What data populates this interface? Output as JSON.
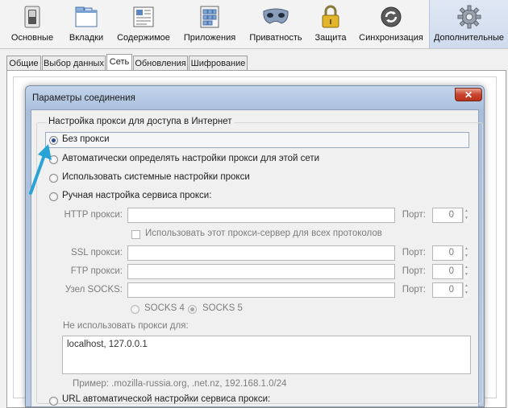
{
  "toolbar": {
    "items": [
      {
        "label": "Основные",
        "icon": "switch-icon"
      },
      {
        "label": "Вкладки",
        "icon": "tabs-icon"
      },
      {
        "label": "Содержимое",
        "icon": "content-icon"
      },
      {
        "label": "Приложения",
        "icon": "applications-icon"
      },
      {
        "label": "Приватность",
        "icon": "privacy-mask-icon"
      },
      {
        "label": "Защита",
        "icon": "padlock-icon"
      },
      {
        "label": "Синхронизация",
        "icon": "sync-icon"
      },
      {
        "label": "Дополнительные",
        "icon": "gear-icon"
      }
    ],
    "active": "Дополнительные"
  },
  "tabs": [
    {
      "label": "Общие"
    },
    {
      "label": "Выбор данных"
    },
    {
      "label": "Сеть"
    },
    {
      "label": "Обновления"
    },
    {
      "label": "Шифрование"
    }
  ],
  "active_tab": "Сеть",
  "dialog": {
    "title": "Параметры соединения",
    "close_label": "✕",
    "legend": "Настройка прокси для доступа в Интернет",
    "options": {
      "no_proxy": "Без прокси",
      "auto_detect": "Автоматически определять настройки прокси для этой сети",
      "system": "Использовать системные настройки прокси",
      "manual": "Ручная настройка сервиса прокси:",
      "auto_url": "URL автоматической настройки сервиса прокси:"
    },
    "selected_option": "no_proxy",
    "manual": {
      "http_label": "HTTP прокси:",
      "ssl_label": "SSL прокси:",
      "ftp_label": "FTP прокси:",
      "socks_label": "Узел SOCKS:",
      "port_label": "Порт:",
      "http_port": "0",
      "ssl_port": "0",
      "ftp_port": "0",
      "socks_port": "0",
      "use_for_all": "Использовать этот прокси-сервер для всех протоколов",
      "socks4": "SOCKS 4",
      "socks5": "SOCKS 5",
      "socks_selected": "SOCKS 5"
    },
    "no_proxy_for_label": "Не использовать прокси для:",
    "no_proxy_for_value": "localhost, 127.0.0.1",
    "example": "Пример: .mozilla-russia.org, .net.nz, 192.168.1.0/24"
  },
  "colors": {
    "annotation_arrow": "#29a3d6",
    "active_toolbar": "#d3dff0",
    "dialog_frame": "#b3c7e2",
    "close_button": "#c8452f"
  }
}
